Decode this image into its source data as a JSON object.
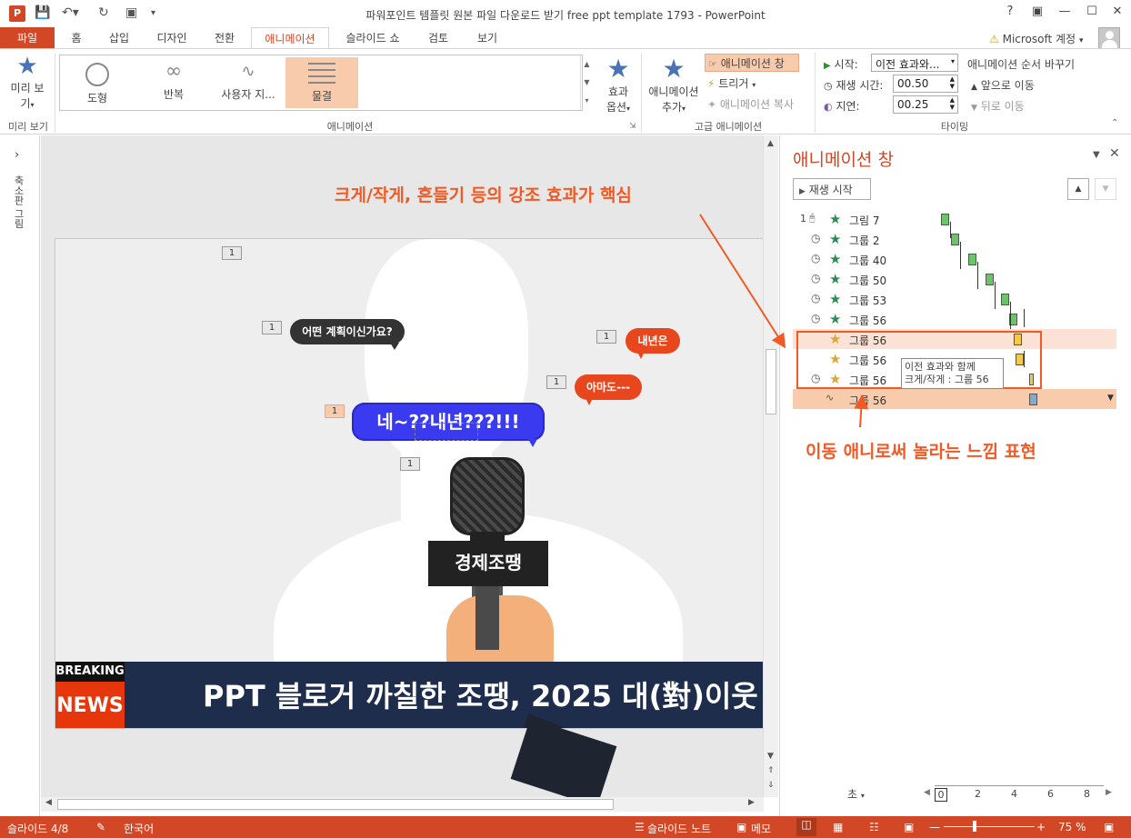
{
  "window": {
    "title": "파워포인트 템플릿 원본 파일 다운로드 받기 free ppt template 1793 - PowerPoint",
    "help": "?",
    "app_icon": "P"
  },
  "tabs": [
    "파일",
    "홈",
    "삽입",
    "디자인",
    "전환",
    "애니메이션",
    "슬라이드 쇼",
    "검토",
    "보기"
  ],
  "account": "Microsoft 계정",
  "ribbon": {
    "preview": {
      "label1": "미리 보",
      "label2": "기",
      "group": "미리 보기"
    },
    "effects": [
      "도형",
      "반복",
      "사용자 지...",
      "물결"
    ],
    "animations_group": "애니메이션",
    "effect_options": {
      "label1": "효과",
      "label2": "옵션"
    },
    "add_animation": {
      "label1": "애니메이션",
      "label2": "추가"
    },
    "animation_pane": "애니메이션 창",
    "trigger": "트리거",
    "animation_painter": "애니메이션 복사",
    "advanced_group": "고급 애니메이션",
    "start_label": "시작:",
    "start_value": "이전 효과와...",
    "duration_label": "재생 시간:",
    "duration_value": "00.50",
    "delay_label": "지연:",
    "delay_value": "00.25",
    "reorder_title": "애니메이션 순서 바꾸기",
    "move_earlier": "앞으로 이동",
    "move_later": "뒤로 이동",
    "timing_group": "타이밍"
  },
  "left_pane": {
    "label": "축소판 그림"
  },
  "slide": {
    "tags": [
      "1",
      "1",
      "1",
      "1",
      "1",
      "1"
    ],
    "bubble_question": "어떤 계획이신가요?",
    "bubble_nextyear": "내년은",
    "bubble_maybe": "아마도---",
    "bubble_yes": "네~??내년???!!!",
    "mic_brand": "경제조땡",
    "breaking": "BREAKING",
    "news": "NEWS",
    "ticker": "PPT 블로거 까칠한 조땡, 2025 대(對)이웃"
  },
  "anim_pane": {
    "title": "애니메이션 창",
    "play_button": "재생 시작",
    "items": [
      {
        "num": "1",
        "icon": "mouse-click",
        "effect": "entrance",
        "name": "그림 7"
      },
      {
        "num": "",
        "icon": "clock",
        "effect": "entrance",
        "name": "그룹 2"
      },
      {
        "num": "",
        "icon": "clock",
        "effect": "entrance",
        "name": "그룹 40"
      },
      {
        "num": "",
        "icon": "clock",
        "effect": "entrance",
        "name": "그룹 50"
      },
      {
        "num": "",
        "icon": "clock",
        "effect": "entrance",
        "name": "그룹 53"
      },
      {
        "num": "",
        "icon": "clock",
        "effect": "entrance",
        "name": "그룹 56"
      },
      {
        "num": "",
        "icon": "",
        "effect": "emphasis",
        "name": "그룹 56"
      },
      {
        "num": "",
        "icon": "",
        "effect": "emphasis",
        "name": "그룹 56"
      },
      {
        "num": "",
        "icon": "clock",
        "effect": "emphasis",
        "name": "그룹 56"
      },
      {
        "num": "",
        "icon": "",
        "effect": "motion-path",
        "name": "그룹 56"
      }
    ],
    "tooltip_line1": "이전 효과와 함께",
    "tooltip_line2": "크게/작게 : 그룹 56",
    "seconds_label": "초",
    "timeline_ticks": [
      "0",
      "2",
      "4",
      "6",
      "8"
    ]
  },
  "annotations": {
    "top": "크게/작게, 흔들기 등의 강조 효과가 핵심",
    "bottom": "이동 애니로써 놀라는 느낌 표현"
  },
  "status": {
    "slide": "슬라이드 4/8",
    "language": "한국어",
    "notes": "슬라이드 노트",
    "comments": "메모",
    "zoom": "75 %"
  },
  "colors": {
    "accent": "#d24726",
    "annotation": "#f15a24",
    "entrance": "#6cc36b",
    "emphasis": "#f2c94c",
    "motion": "#8aa9c4"
  }
}
